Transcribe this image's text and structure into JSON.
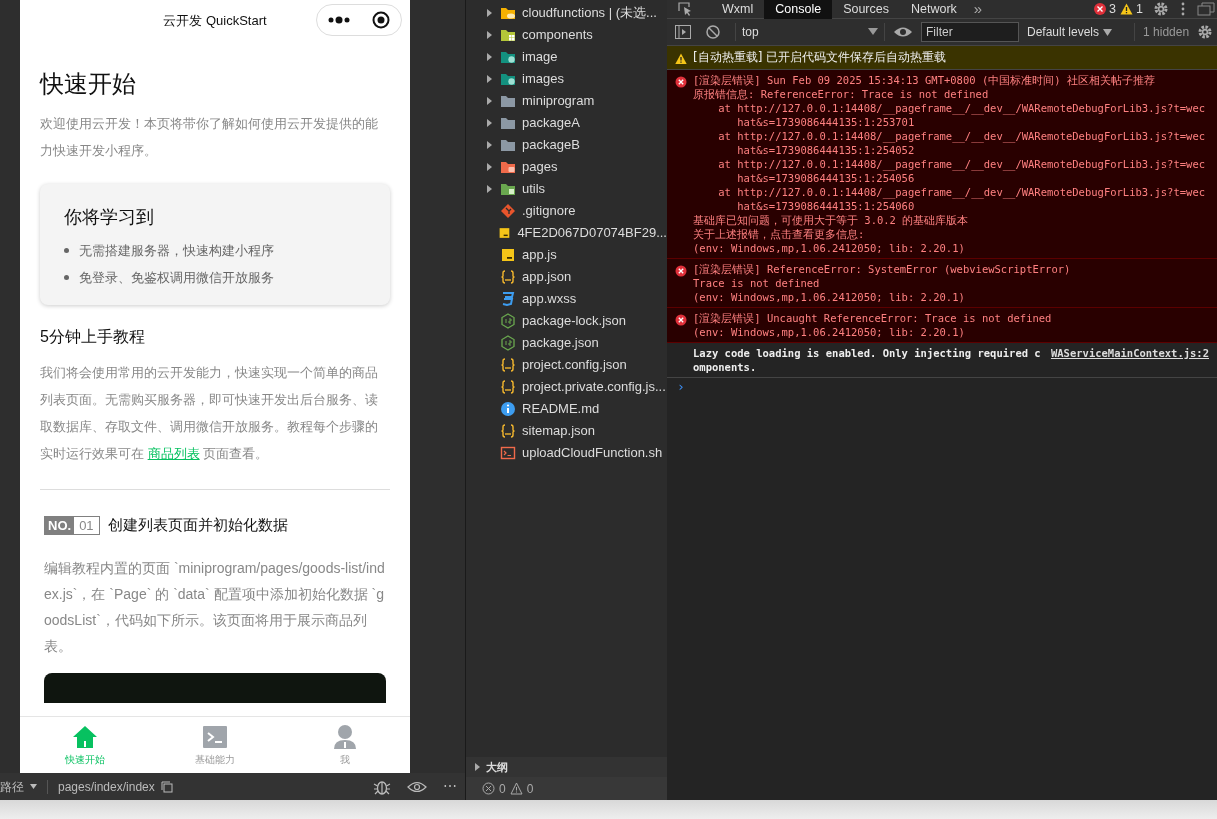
{
  "simulator": {
    "nav_title": "云开发 QuickStart",
    "page": {
      "title": "快速开始",
      "intro": "欢迎使用云开发！本页将带你了解如何使用云开发提供的能力快速开发小程序。",
      "learn_card": {
        "title": "你将学习到",
        "items": [
          "无需搭建服务器，快速构建小程序",
          "免登录、免鉴权调用微信开放服务"
        ]
      },
      "tutorial": {
        "title": "5分钟上手教程",
        "text_before": "我们将会使用常用的云开发能力，快速实现一个简单的商品列表页面。无需购买服务器，即可快速开发出后台服务、读取数据库、存取文件、调用微信开放服务。教程每个步骤的实时运行效果可在",
        "link": "商品列表",
        "text_after": "页面查看。"
      },
      "step": {
        "no_label": "NO.",
        "number": "01",
        "title": "创建列表页面并初始化数据",
        "body": "编辑教程内置的页面 `miniprogram/pages/goods-list/index.js`，在 `Page` 的 `data` 配置项中添加初始化数据 `goodsList`，代码如下所示。该页面将用于展示商品列表。"
      }
    },
    "tabbar": [
      {
        "label": "快速开始",
        "kind": "home",
        "selected": true
      },
      {
        "label": "基础能力",
        "kind": "terminal",
        "selected": false
      },
      {
        "label": "我",
        "kind": "person",
        "selected": false
      }
    ],
    "path_bar": {
      "label": "路径",
      "path": "pages/index/index",
      "more": "⋯"
    }
  },
  "file_tree": {
    "items": [
      {
        "name": "cloudfunctions | (未选...",
        "kind": "cloud-folder",
        "expanded": false
      },
      {
        "name": "components",
        "kind": "component-folder",
        "expanded": false
      },
      {
        "name": "image",
        "kind": "image-folder",
        "expanded": false
      },
      {
        "name": "images",
        "kind": "image-folder",
        "expanded": false
      },
      {
        "name": "miniprogram",
        "kind": "folder",
        "expanded": false
      },
      {
        "name": "packageA",
        "kind": "folder",
        "expanded": false
      },
      {
        "name": "packageB",
        "kind": "folder",
        "expanded": false
      },
      {
        "name": "pages",
        "kind": "pages-folder",
        "expanded": false
      },
      {
        "name": "utils",
        "kind": "utils-folder",
        "expanded": false
      },
      {
        "name": ".gitignore",
        "kind": "git"
      },
      {
        "name": "4FE2D067D07074BF29...",
        "kind": "js"
      },
      {
        "name": "app.js",
        "kind": "js"
      },
      {
        "name": "app.json",
        "kind": "json"
      },
      {
        "name": "app.wxss",
        "kind": "css"
      },
      {
        "name": "package-lock.json",
        "kind": "node"
      },
      {
        "name": "package.json",
        "kind": "node"
      },
      {
        "name": "project.config.json",
        "kind": "json"
      },
      {
        "name": "project.private.config.js...",
        "kind": "json"
      },
      {
        "name": "README.md",
        "kind": "info"
      },
      {
        "name": "sitemap.json",
        "kind": "json"
      },
      {
        "name": "uploadCloudFunction.sh",
        "kind": "shell"
      }
    ],
    "outline": {
      "label": "大纲",
      "expanded": false
    },
    "status": {
      "errors": "0",
      "warnings": "0"
    }
  },
  "devtools": {
    "tabs": [
      {
        "label": "Wxml",
        "selected": false
      },
      {
        "label": "Console",
        "selected": true
      },
      {
        "label": "Sources",
        "selected": false
      },
      {
        "label": "Network",
        "selected": false
      }
    ],
    "more_tabs": "»",
    "error_count": "3",
    "warning_count": "1",
    "toolbar": {
      "context": "top",
      "filter_placeholder": "Filter",
      "levels": "Default levels",
      "hidden": "1 hidden"
    },
    "messages": [
      {
        "kind": "warning",
        "lines": [
          {
            "kind": "text",
            "text": "[自动热重载] 已开启代码文件保存后自动热重载"
          }
        ]
      },
      {
        "kind": "error",
        "lines": [
          {
            "kind": "text",
            "text": "[渲染层错误] Sun Feb 09 2025 15:34:13 GMT+0800 (中国标准时间) 社区相关帖子推荐"
          },
          {
            "kind": "text",
            "text": " 原报错信息: ReferenceError: Trace is not defined"
          },
          {
            "kind": "stack",
            "prefix": "at",
            "url": "http://127.0.0.1:14408/__pageframe__/__dev__/WARemoteDebugForLib3.js?t=wechat&s=1739086444135:1:253701"
          },
          {
            "kind": "stack",
            "prefix": "at",
            "url": "http://127.0.0.1:14408/__pageframe__/__dev__/WARemoteDebugForLib3.js?t=wechat&s=1739086444135:1:254052"
          },
          {
            "kind": "stack",
            "prefix": "at",
            "url": "http://127.0.0.1:14408/__pageframe__/__dev__/WARemoteDebugForLib3.js?t=wechat&s=1739086444135:1:254056"
          },
          {
            "kind": "stack",
            "prefix": "at",
            "url": "http://127.0.0.1:14408/__pageframe__/__dev__/WARemoteDebugForLib3.js?t=wechat&s=1739086444135:1:254060"
          },
          {
            "kind": "text",
            "text": " 基础库已知问题，可使用大于等于 3.0.2 的基础库版本"
          },
          {
            "kind": "text",
            "text": " 关于上述报错，点击查看更多信息:"
          },
          {
            "kind": "text",
            "text": "(env: Windows,mp,1.06.2412050; lib: 2.20.1)"
          }
        ]
      },
      {
        "kind": "error",
        "lines": [
          {
            "kind": "text",
            "text": "[渲染层错误] ReferenceError: SystemError (webviewScriptError)"
          },
          {
            "kind": "text",
            "text": "Trace is not defined"
          },
          {
            "kind": "text",
            "text": "(env: Windows,mp,1.06.2412050; lib: 2.20.1)"
          }
        ]
      },
      {
        "kind": "error",
        "lines": [
          {
            "kind": "text",
            "text": "[渲染层错误] Uncaught ReferenceError: Trace is not defined"
          },
          {
            "kind": "text",
            "text": "(env: Windows,mp,1.06.2412050; lib: 2.20.1)"
          }
        ]
      },
      {
        "kind": "info",
        "lines": [
          {
            "kind": "text",
            "text": "Lazy code loading is enabled. Only injecting required components."
          }
        ],
        "source": "WAServiceMainContext.js:2"
      }
    ],
    "prompt": "›"
  }
}
